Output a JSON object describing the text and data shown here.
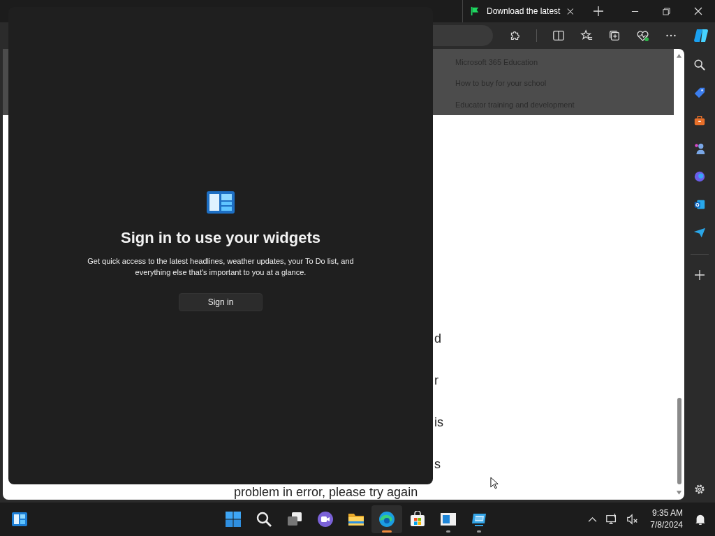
{
  "browser": {
    "tab": {
      "title": "Download the latest",
      "selected": true
    },
    "menu_items": [
      "Microsoft 365 Education",
      "How to buy for your school",
      "Educator training and development"
    ],
    "page_fragments": [
      "d",
      "r",
      "is",
      "s"
    ],
    "page_line": "problem in error, please try again"
  },
  "widgets_panel": {
    "heading": "Sign in to use your widgets",
    "description": "Get quick access to the latest headlines, weather updates, your To Do list, and everything else that's important to you at a glance.",
    "button": "Sign in"
  },
  "taskbar": {
    "apps": [
      {
        "kind": "start",
        "running": false,
        "active": false
      },
      {
        "kind": "search",
        "running": false,
        "active": false
      },
      {
        "kind": "taskview",
        "running": false,
        "active": false
      },
      {
        "kind": "chat",
        "running": false,
        "active": false
      },
      {
        "kind": "files",
        "running": false,
        "active": false
      },
      {
        "kind": "edge",
        "running": true,
        "active": true
      },
      {
        "kind": "store",
        "running": false,
        "active": false
      },
      {
        "kind": "window",
        "running": true,
        "active": false
      },
      {
        "kind": "remote",
        "running": true,
        "active": false
      }
    ],
    "time": "9:35 AM",
    "date": "7/8/2024"
  }
}
